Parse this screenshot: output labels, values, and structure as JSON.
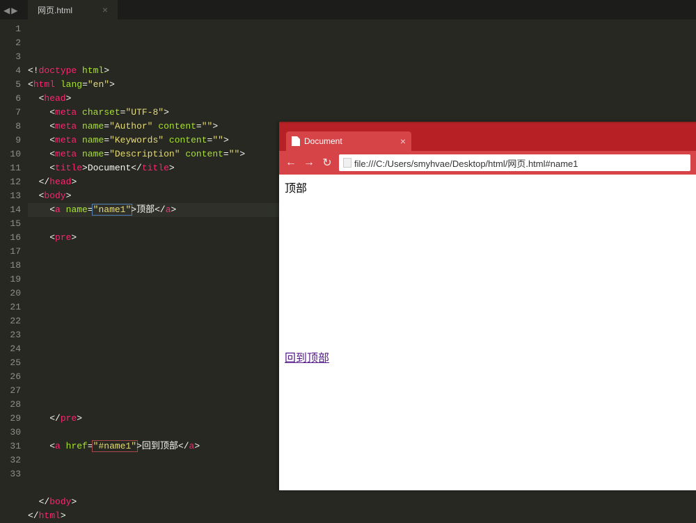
{
  "editor": {
    "tab_name": "网页.html",
    "tab_close": "×",
    "lines": [
      [
        [
          "w",
          "<!"
        ],
        [
          "pink",
          "doctype"
        ],
        [
          "w",
          " "
        ],
        [
          "green",
          "html"
        ],
        [
          "w",
          ">"
        ]
      ],
      [
        [
          "w",
          "<"
        ],
        [
          "pink",
          "html"
        ],
        [
          "w",
          " "
        ],
        [
          "green",
          "lang"
        ],
        [
          "w",
          "="
        ],
        [
          "yellow",
          "\"en\""
        ],
        [
          "w",
          ">"
        ]
      ],
      [
        [
          "w",
          "  <"
        ],
        [
          "pink",
          "head"
        ],
        [
          "w",
          ">"
        ]
      ],
      [
        [
          "w",
          "    <"
        ],
        [
          "pink",
          "meta"
        ],
        [
          "w",
          " "
        ],
        [
          "green",
          "charset"
        ],
        [
          "w",
          "="
        ],
        [
          "yellow",
          "\"UTF-8\""
        ],
        [
          "w",
          ">"
        ]
      ],
      [
        [
          "w",
          "    <"
        ],
        [
          "pink",
          "meta"
        ],
        [
          "w",
          " "
        ],
        [
          "green",
          "name"
        ],
        [
          "w",
          "="
        ],
        [
          "yellow",
          "\"Author\""
        ],
        [
          "w",
          " "
        ],
        [
          "green",
          "content"
        ],
        [
          "w",
          "="
        ],
        [
          "yellow",
          "\"\""
        ],
        [
          "w",
          ">"
        ]
      ],
      [
        [
          "w",
          "    <"
        ],
        [
          "pink",
          "meta"
        ],
        [
          "w",
          " "
        ],
        [
          "green",
          "name"
        ],
        [
          "w",
          "="
        ],
        [
          "yellow",
          "\"Keywords\""
        ],
        [
          "w",
          " "
        ],
        [
          "green",
          "content"
        ],
        [
          "w",
          "="
        ],
        [
          "yellow",
          "\"\""
        ],
        [
          "w",
          ">"
        ]
      ],
      [
        [
          "w",
          "    <"
        ],
        [
          "pink",
          "meta"
        ],
        [
          "w",
          " "
        ],
        [
          "green",
          "name"
        ],
        [
          "w",
          "="
        ],
        [
          "yellow",
          "\"Description\""
        ],
        [
          "w",
          " "
        ],
        [
          "green",
          "content"
        ],
        [
          "w",
          "="
        ],
        [
          "yellow",
          "\"\""
        ],
        [
          "w",
          ">"
        ]
      ],
      [
        [
          "w",
          "    <"
        ],
        [
          "pink",
          "title"
        ],
        [
          "w",
          ">Document</"
        ],
        [
          "pink",
          "title"
        ],
        [
          "w",
          ">"
        ]
      ],
      [
        [
          "w",
          "  </"
        ],
        [
          "pink",
          "head"
        ],
        [
          "w",
          ">"
        ]
      ],
      [
        [
          "w",
          "  <"
        ],
        [
          "pink",
          "body"
        ],
        [
          "w",
          ">"
        ]
      ],
      [
        [
          "w",
          "    <"
        ],
        [
          "pink",
          "a"
        ],
        [
          "w",
          " "
        ],
        [
          "green",
          "name"
        ],
        [
          "w",
          "="
        ],
        [
          "yellow-box-blue",
          "\"name1\""
        ],
        [
          "w",
          ">顶部</"
        ],
        [
          "pink",
          "a"
        ],
        [
          "w",
          ">"
        ]
      ],
      [],
      [
        [
          "w",
          "    <"
        ],
        [
          "pink",
          "pre"
        ],
        [
          "w",
          ">"
        ]
      ],
      [],
      [],
      [],
      [],
      [],
      [],
      [],
      [],
      [],
      [],
      [],
      [],
      [
        [
          "w",
          "    </"
        ],
        [
          "pink",
          "pre"
        ],
        [
          "w",
          ">"
        ]
      ],
      [],
      [
        [
          "w",
          "    <"
        ],
        [
          "pink",
          "a"
        ],
        [
          "w",
          " "
        ],
        [
          "green",
          "href"
        ],
        [
          "w",
          "="
        ],
        [
          "yellow-box-red",
          "\"#name1\""
        ],
        [
          "w",
          ">回到顶部</"
        ],
        [
          "pink",
          "a"
        ],
        [
          "w",
          ">"
        ]
      ],
      [],
      [],
      [],
      [
        [
          "w",
          "  </"
        ],
        [
          "pink",
          "body"
        ],
        [
          "w",
          ">"
        ]
      ],
      [
        [
          "w",
          "</"
        ],
        [
          "pink",
          "html"
        ],
        [
          "w",
          ">"
        ]
      ]
    ]
  },
  "browser": {
    "tab_title": "Document",
    "tab_close": "×",
    "url": "file:///C:/Users/smyhvae/Desktop/html/网页.html#name1",
    "content_top": "顶部",
    "content_link": "回到顶部",
    "nav_back": "←",
    "nav_forward": "→",
    "nav_reload": "↻"
  }
}
